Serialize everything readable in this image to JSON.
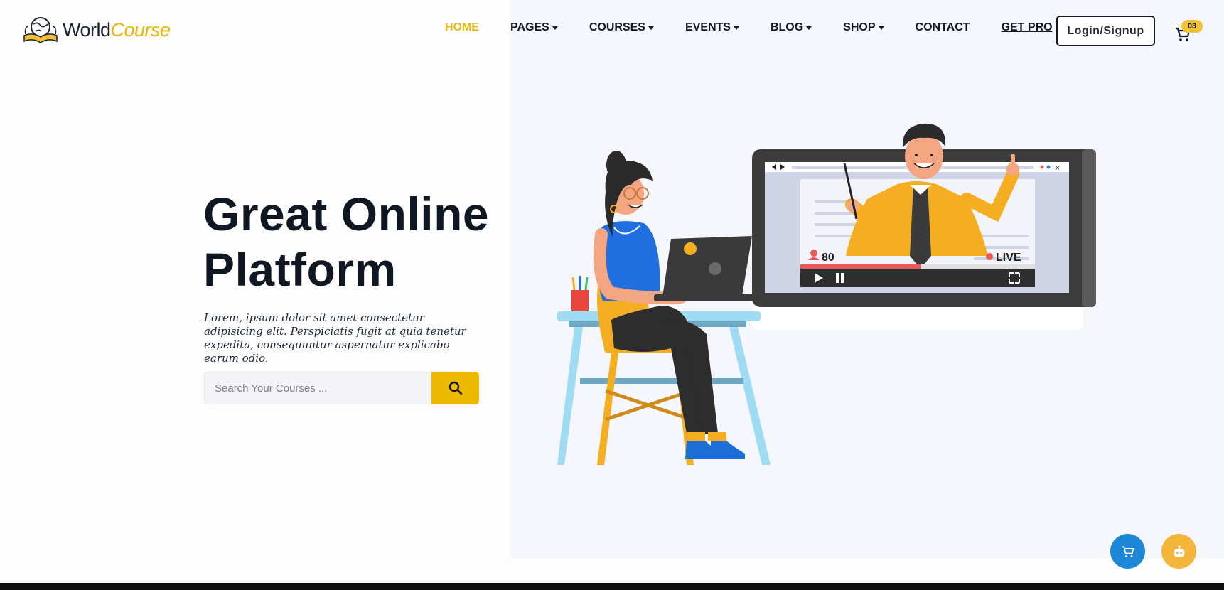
{
  "logo": {
    "word": "World",
    "accent": "Course"
  },
  "nav": {
    "home": "HOME",
    "pages": "PAGES",
    "courses": "COURSES",
    "events": "EVENTS",
    "blog": "BLOG",
    "shop": "SHOP",
    "contact": "CONTACT",
    "get_pro": "GET PRO"
  },
  "header": {
    "login_label": "Login/Signup",
    "cart_count": "03"
  },
  "hero": {
    "title_line1": "Great Online",
    "title_line2": "Platform",
    "description": "Lorem, ipsum dolor sit amet consectetur adipisicing elit. Perspiciatis fugit at quia tenetur expedita, consequuntur aspernatur explicabo earum odio.",
    "search_placeholder": "Search Your Courses ..."
  },
  "illustration": {
    "viewer_count": "80",
    "live_label": "LIVE"
  },
  "colors": {
    "accent": "#ecb800",
    "dark": "#0f1722",
    "blue": "#1e88d8",
    "orange": "#f4b63a"
  },
  "icons": {
    "search": "search-icon",
    "cart": "cart-icon",
    "float_cart": "cart-icon",
    "float_bot": "robot-icon"
  }
}
